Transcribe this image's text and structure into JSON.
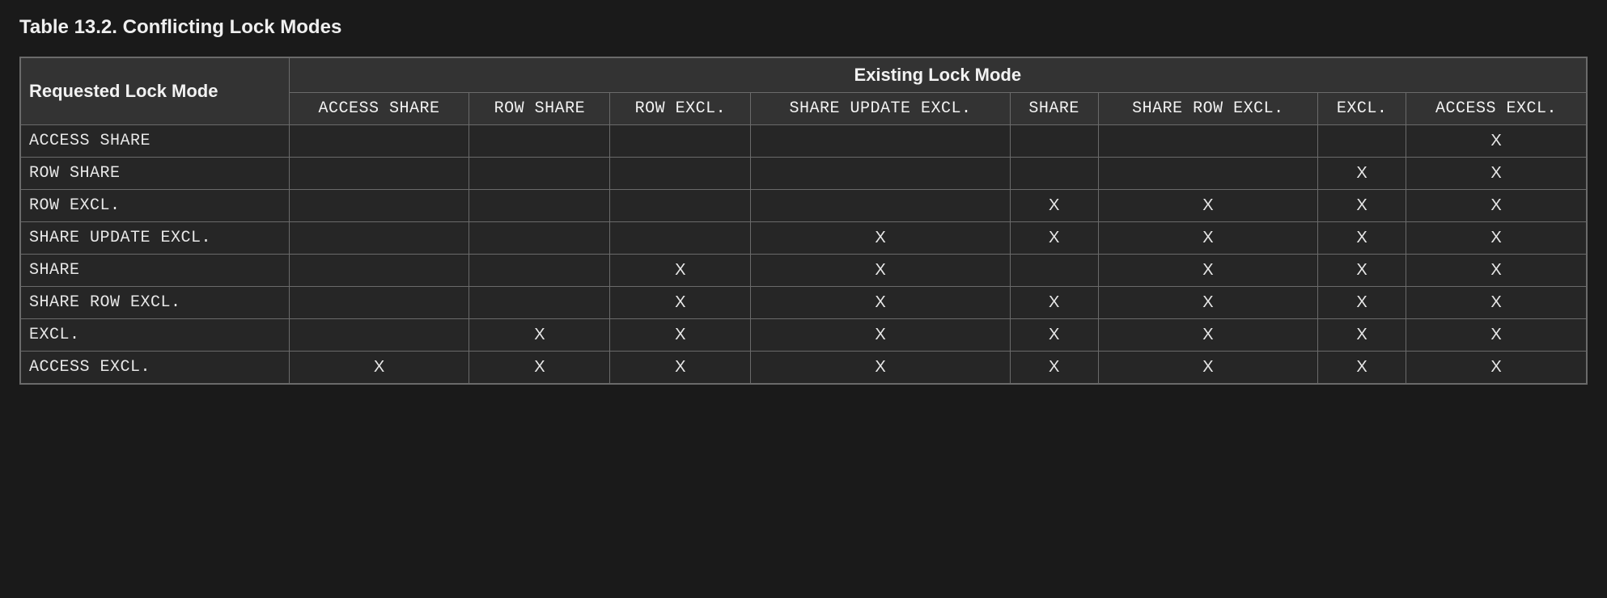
{
  "caption": "Table 13.2. Conflicting Lock Modes",
  "cornerHeader": "Requested Lock Mode",
  "superHeader": "Existing Lock Mode",
  "columns": [
    "ACCESS SHARE",
    "ROW SHARE",
    "ROW EXCL.",
    "SHARE UPDATE EXCL.",
    "SHARE",
    "SHARE ROW EXCL.",
    "EXCL.",
    "ACCESS EXCL."
  ],
  "rows": [
    {
      "label": "ACCESS SHARE",
      "cells": [
        "",
        "",
        "",
        "",
        "",
        "",
        "",
        "X"
      ]
    },
    {
      "label": "ROW SHARE",
      "cells": [
        "",
        "",
        "",
        "",
        "",
        "",
        "X",
        "X"
      ]
    },
    {
      "label": "ROW EXCL.",
      "cells": [
        "",
        "",
        "",
        "",
        "X",
        "X",
        "X",
        "X"
      ]
    },
    {
      "label": "SHARE UPDATE EXCL.",
      "cells": [
        "",
        "",
        "",
        "X",
        "X",
        "X",
        "X",
        "X"
      ]
    },
    {
      "label": "SHARE",
      "cells": [
        "",
        "",
        "X",
        "X",
        "",
        "X",
        "X",
        "X"
      ]
    },
    {
      "label": "SHARE ROW EXCL.",
      "cells": [
        "",
        "",
        "X",
        "X",
        "X",
        "X",
        "X",
        "X"
      ]
    },
    {
      "label": "EXCL.",
      "cells": [
        "",
        "X",
        "X",
        "X",
        "X",
        "X",
        "X",
        "X"
      ]
    },
    {
      "label": "ACCESS EXCL.",
      "cells": [
        "X",
        "X",
        "X",
        "X",
        "X",
        "X",
        "X",
        "X"
      ]
    }
  ],
  "chart_data": {
    "type": "table",
    "title": "Table 13.2. Conflicting Lock Modes",
    "row_axis": "Requested Lock Mode",
    "col_axis": "Existing Lock Mode",
    "row_labels": [
      "ACCESS SHARE",
      "ROW SHARE",
      "ROW EXCL.",
      "SHARE UPDATE EXCL.",
      "SHARE",
      "SHARE ROW EXCL.",
      "EXCL.",
      "ACCESS EXCL."
    ],
    "col_labels": [
      "ACCESS SHARE",
      "ROW SHARE",
      "ROW EXCL.",
      "SHARE UPDATE EXCL.",
      "SHARE",
      "SHARE ROW EXCL.",
      "EXCL.",
      "ACCESS EXCL."
    ],
    "matrix": [
      [
        0,
        0,
        0,
        0,
        0,
        0,
        0,
        1
      ],
      [
        0,
        0,
        0,
        0,
        0,
        0,
        1,
        1
      ],
      [
        0,
        0,
        0,
        0,
        1,
        1,
        1,
        1
      ],
      [
        0,
        0,
        0,
        1,
        1,
        1,
        1,
        1
      ],
      [
        0,
        0,
        1,
        1,
        0,
        1,
        1,
        1
      ],
      [
        0,
        0,
        1,
        1,
        1,
        1,
        1,
        1
      ],
      [
        0,
        1,
        1,
        1,
        1,
        1,
        1,
        1
      ],
      [
        1,
        1,
        1,
        1,
        1,
        1,
        1,
        1
      ]
    ],
    "legend": {
      "1": "X (conflict)",
      "0": ""
    }
  }
}
